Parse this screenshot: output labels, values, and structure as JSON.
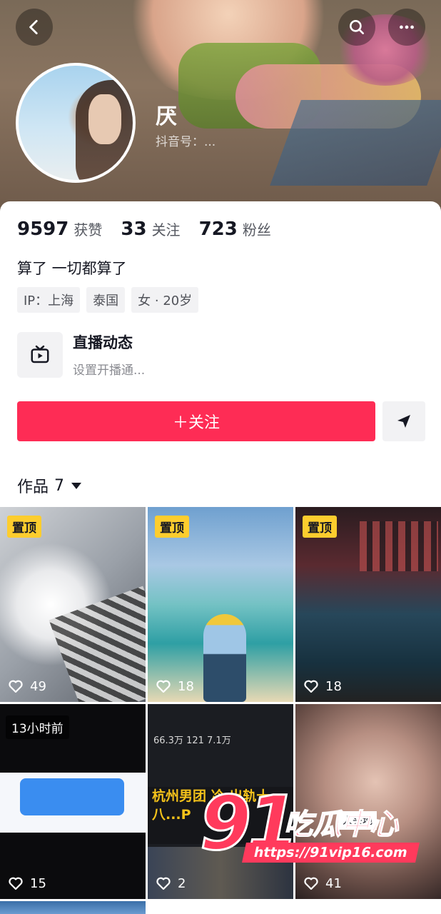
{
  "header": {
    "nickname": "厌",
    "douyin_id": "抖音号：...",
    "back_icon": "back-arrow-icon",
    "search_icon": "search-icon",
    "more_icon": "more-dots-icon"
  },
  "stats": [
    {
      "num": "9597",
      "label": "获赞"
    },
    {
      "num": "33",
      "label": "关注"
    },
    {
      "num": "723",
      "label": "粉丝"
    }
  ],
  "bio": "算了 一切都算了",
  "tags": [
    "IP：上海",
    "泰国",
    "女 · 20岁"
  ],
  "live": {
    "title": "直播动态",
    "subtitle": "设置开播通..."
  },
  "actions": {
    "follow_label": "＋关注",
    "message_icon": "send-icon"
  },
  "works_tab": {
    "label": "作品",
    "count": "7"
  },
  "videos": [
    {
      "pinned": "置顶",
      "likes": "49"
    },
    {
      "pinned": "置顶",
      "likes": "18"
    },
    {
      "pinned": "置顶",
      "likes": "18"
    },
    {
      "time": "13小时前",
      "likes": "15"
    },
    {
      "likes": "2",
      "overlay_text": "杭州男团 冷 出轨十八...P",
      "stats_text": "66.3万   121   7.1万"
    },
    {
      "likes": "41",
      "caption": "人头地"
    }
  ],
  "watermark": {
    "logo_num": "91",
    "logo_text": "吃瓜中心",
    "url": "https://91vip16.com"
  },
  "colors": {
    "accent": "#fe2c55",
    "pin_badge": "#fdcd2e"
  }
}
